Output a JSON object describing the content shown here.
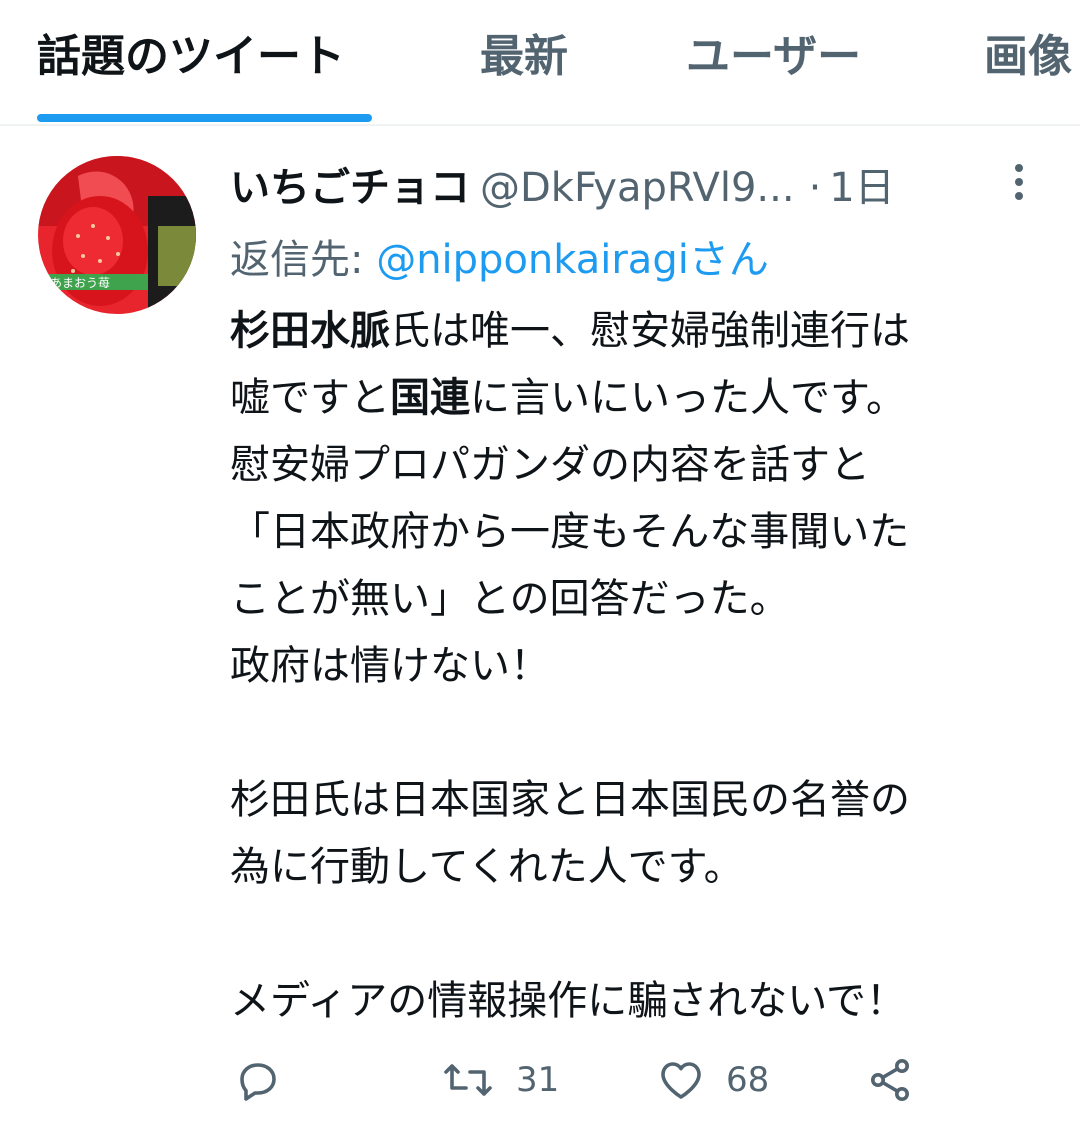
{
  "tabs": [
    {
      "label": "話題のツイート",
      "active": true
    },
    {
      "label": "最新",
      "active": false
    },
    {
      "label": "ユーザー",
      "active": false
    },
    {
      "label": "画像",
      "active": false
    }
  ],
  "tweet": {
    "display_name": "いちごチョコ",
    "handle": "@DkFyapRVl9...",
    "separator": "·",
    "time": "1日",
    "reply_prefix": "返信先: ",
    "reply_handle": "@nipponkairagi",
    "reply_suffix": "さん",
    "avatar_label": "あまおう苺",
    "body": {
      "l1_bold": "杉田水脈",
      "l1_rest": "氏は唯一、慰安婦強制連行は",
      "l2_a": "嘘ですと",
      "l2_bold": "国連",
      "l2_b": "に言いにいった人です。",
      "l3": "慰安婦プロパガンダの内容を話すと",
      "l4": "「日本政府から一度もそんな事聞いた",
      "l5": "ことが無い」との回答だった。",
      "l6": "政府は情けない！",
      "l7": "杉田氏は日本国家と日本国民の名誉の",
      "l8": "為に行動してくれた人です。",
      "l9": "メディアの情報操作に騙されないで！"
    },
    "actions": {
      "reply_count": "",
      "retweet_count": "31",
      "like_count": "68"
    },
    "icons": {
      "reply": "reply-icon",
      "retweet": "retweet-icon",
      "like": "heart-icon",
      "share": "share-icon",
      "more": "more-vertical-icon"
    }
  },
  "colors": {
    "accent": "#1d9bf0",
    "secondary_text": "#536471",
    "primary_text": "#0f1419"
  }
}
